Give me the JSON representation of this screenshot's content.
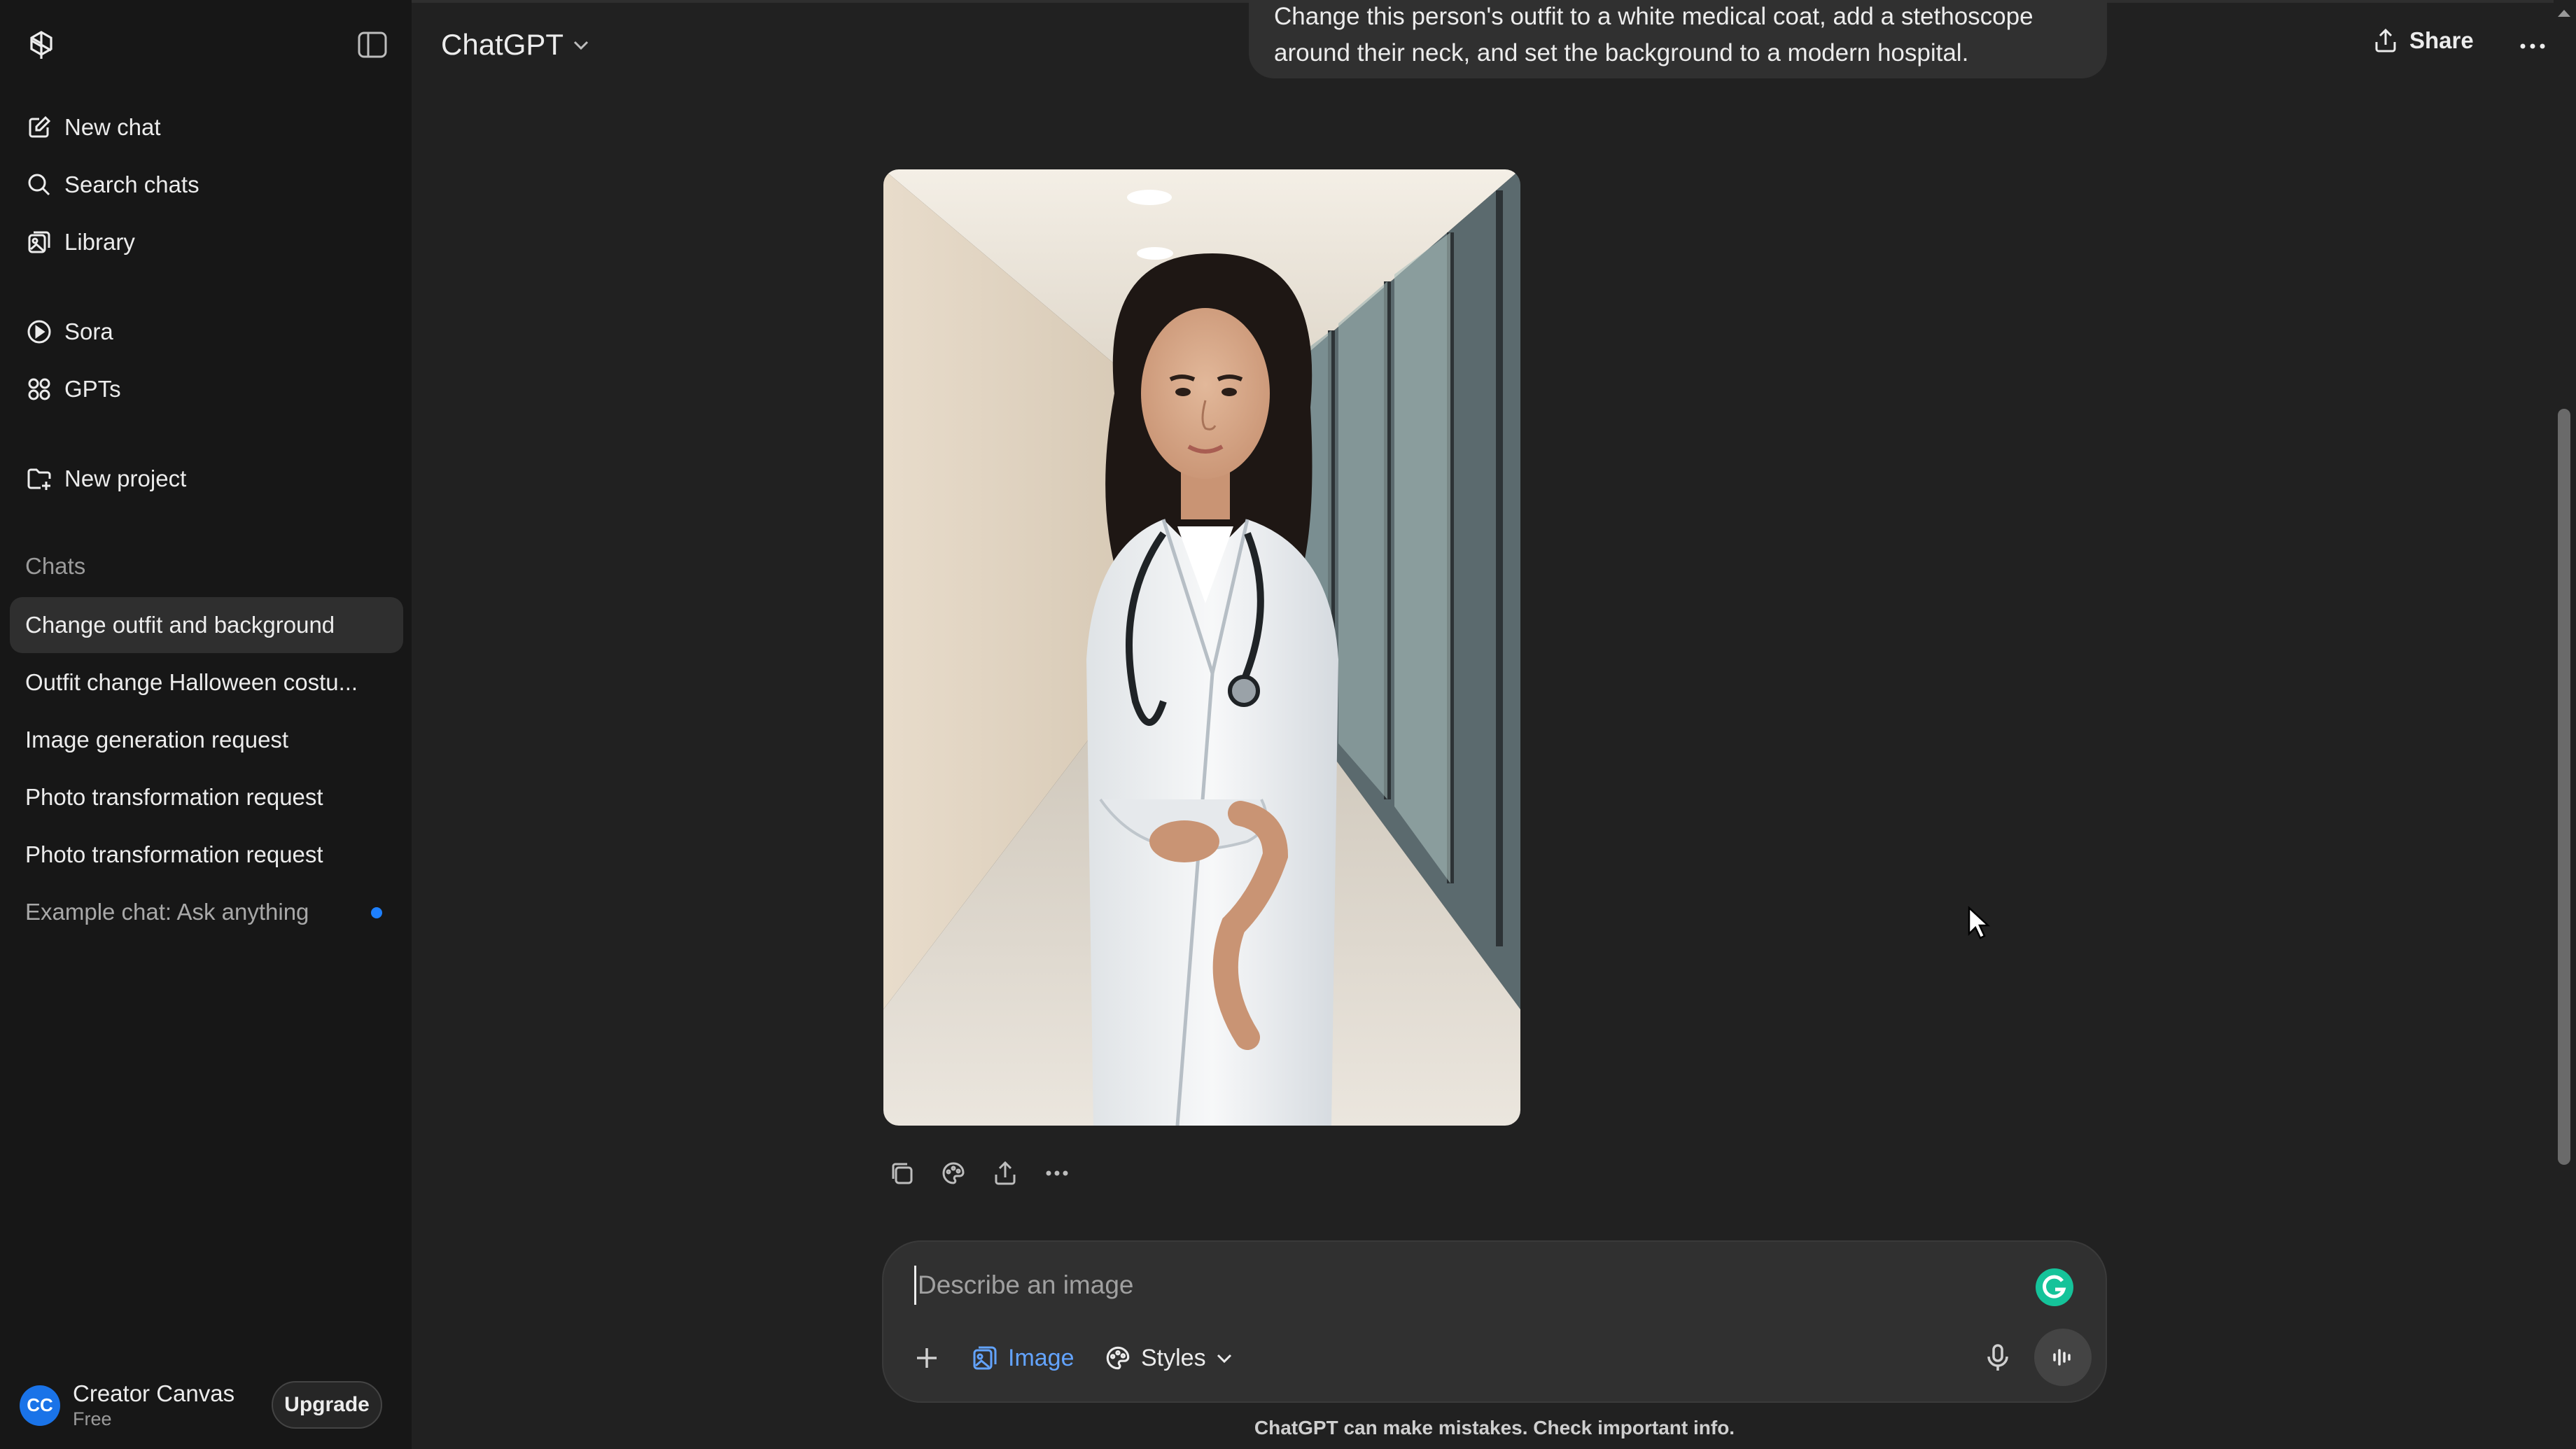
{
  "sidebar": {
    "nav": [
      {
        "label": "New chat",
        "icon": "new-chat-icon"
      },
      {
        "label": "Search chats",
        "icon": "search-icon"
      },
      {
        "label": "Library",
        "icon": "library-icon"
      },
      {
        "label": "Sora",
        "icon": "play-circle-icon"
      },
      {
        "label": "GPTs",
        "icon": "grid-icon"
      },
      {
        "label": "New project",
        "icon": "folder-plus-icon"
      }
    ],
    "chats_label": "Chats",
    "chats": [
      {
        "title": "Change outfit and background",
        "active": true
      },
      {
        "title": "Outfit change Halloween costu..."
      },
      {
        "title": "Image generation request"
      },
      {
        "title": "Photo transformation request"
      },
      {
        "title": "Photo transformation request"
      },
      {
        "title": "Example chat: Ask anything",
        "unread": true
      }
    ],
    "profile": {
      "initials": "CC",
      "name": "Creator Canvas",
      "plan": "Free"
    },
    "upgrade_label": "Upgrade"
  },
  "header": {
    "model": "ChatGPT",
    "share_label": "Share"
  },
  "conversation": {
    "user_message_line1": "Change this person's outfit to a white medical coat, add a stethoscope",
    "user_message_line2": "around their neck, and set the background to a modern hospital."
  },
  "composer": {
    "placeholder": "Describe an image",
    "image_label": "Image",
    "styles_label": "Styles"
  },
  "footer": {
    "disclaimer": "ChatGPT can make mistakes. Check important info."
  },
  "colors": {
    "background": "#212121",
    "sidebar": "#171717",
    "accent_blue": "#63a4ff",
    "unread_dot": "#1e80ff"
  }
}
